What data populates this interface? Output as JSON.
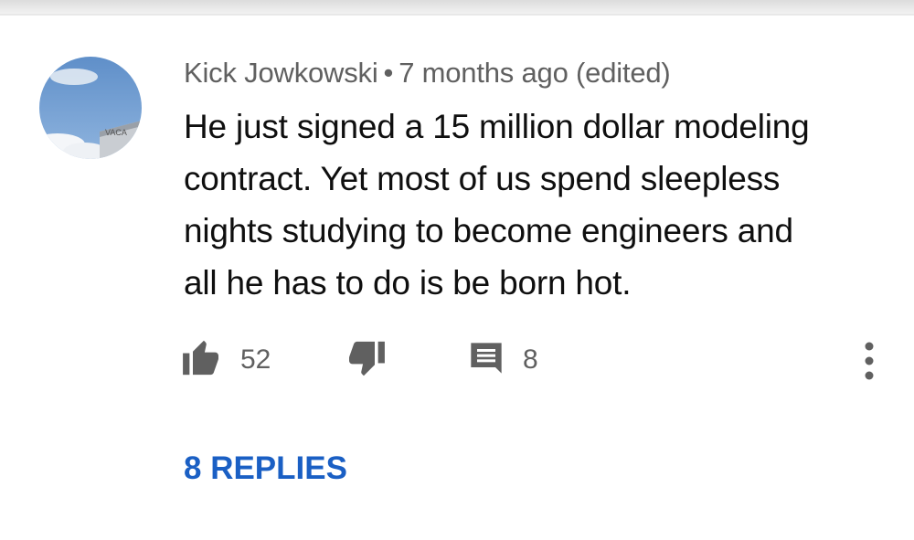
{
  "comment": {
    "author": "Kick Jowkowski",
    "separator": "•",
    "time": "7 months ago (edited)",
    "text_lines": [
      "He just signed a 15 million dollar modeling",
      "contract. Yet most of us spend sleepless",
      "nights studying to become engineers and",
      "all he has to do is be born hot."
    ]
  },
  "actions": {
    "like_count": "52",
    "reply_count": "8"
  },
  "replies_link": "8 REPLIES",
  "icons": {
    "like": "thumbs-up-icon",
    "dislike": "thumbs-down-icon",
    "reply": "comment-icon",
    "more": "more-vert-icon"
  },
  "colors": {
    "link": "#1a5fc4",
    "text": "#0f0f0f",
    "secondary": "#606060"
  }
}
